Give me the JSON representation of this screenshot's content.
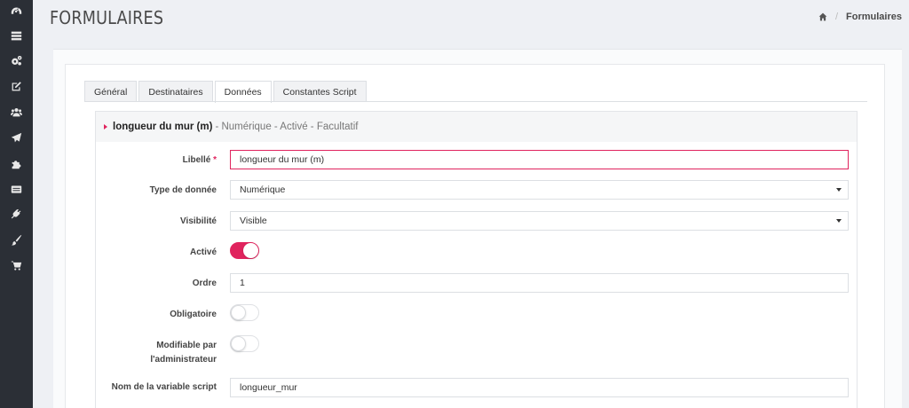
{
  "sidebar": {
    "items": [
      {
        "icon": "dashboard-icon"
      },
      {
        "icon": "list-icon"
      },
      {
        "icon": "cogs-icon"
      },
      {
        "icon": "edit-icon"
      },
      {
        "icon": "users-icon"
      },
      {
        "icon": "send-icon"
      },
      {
        "icon": "puzzle-icon"
      },
      {
        "icon": "id-card-icon"
      },
      {
        "icon": "plug-icon"
      },
      {
        "icon": "brush-icon"
      },
      {
        "icon": "cart-icon"
      }
    ]
  },
  "header": {
    "title": "FORMULAIRES",
    "breadcrumb": {
      "home_icon": "home-icon",
      "current": "Formulaires"
    }
  },
  "tabs": [
    {
      "label": "Général",
      "active": false
    },
    {
      "label": "Destinataires",
      "active": false
    },
    {
      "label": "Données",
      "active": true
    },
    {
      "label": "Constantes Script",
      "active": false
    }
  ],
  "section": {
    "name": "longueur du mur (m)",
    "meta": "- Numérique - Activé - Facultatif"
  },
  "form": {
    "libelle": {
      "label": "Libellé",
      "required_mark": "*",
      "value": "longueur du mur (m)"
    },
    "type": {
      "label": "Type de donnée",
      "value": "Numérique"
    },
    "visibilite": {
      "label": "Visibilité",
      "value": "Visible"
    },
    "active": {
      "label": "Activé",
      "on": true
    },
    "ordre": {
      "label": "Ordre",
      "value": "1"
    },
    "obligatoire": {
      "label": "Obligatoire",
      "on": false
    },
    "modifiable": {
      "label_line1": "Modifiable par",
      "label_line2": "l'administrateur",
      "on": false
    },
    "variable": {
      "label": "Nom de la variable script",
      "value": "longueur_mur"
    }
  },
  "colors": {
    "accent": "#e0245e",
    "sidebar": "#2b2f36"
  }
}
